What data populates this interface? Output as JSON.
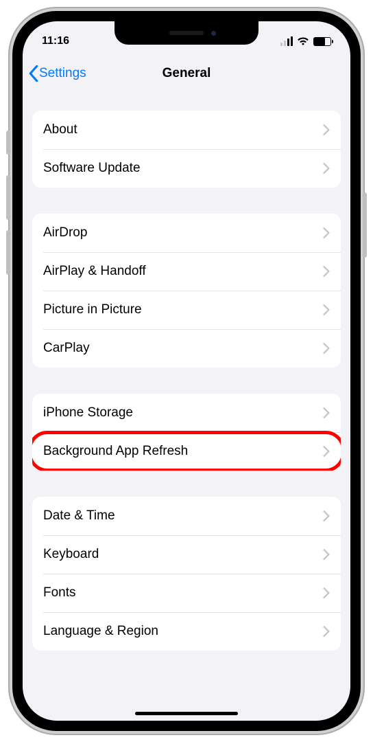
{
  "status_bar": {
    "time": "11:16"
  },
  "nav": {
    "back_label": "Settings",
    "title": "General"
  },
  "sections": [
    {
      "items": [
        {
          "key": "about",
          "label": "About"
        },
        {
          "key": "software-update",
          "label": "Software Update"
        }
      ]
    },
    {
      "items": [
        {
          "key": "airdrop",
          "label": "AirDrop"
        },
        {
          "key": "airplay-handoff",
          "label": "AirPlay & Handoff"
        },
        {
          "key": "picture-in-picture",
          "label": "Picture in Picture"
        },
        {
          "key": "carplay",
          "label": "CarPlay"
        }
      ]
    },
    {
      "items": [
        {
          "key": "iphone-storage",
          "label": "iPhone Storage"
        },
        {
          "key": "background-app-refresh",
          "label": "Background App Refresh",
          "highlighted": true
        }
      ]
    },
    {
      "items": [
        {
          "key": "date-time",
          "label": "Date & Time"
        },
        {
          "key": "keyboard",
          "label": "Keyboard"
        },
        {
          "key": "fonts",
          "label": "Fonts"
        },
        {
          "key": "language-region",
          "label": "Language & Region"
        }
      ]
    }
  ],
  "colors": {
    "accent": "#007aff",
    "highlight_ring": "#ff0000",
    "bg": "#f2f2f7"
  }
}
